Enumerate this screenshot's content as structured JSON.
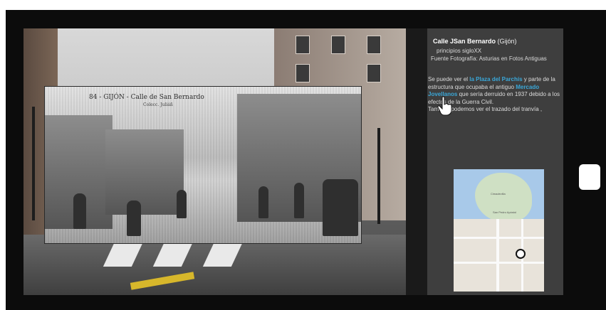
{
  "info_panel": {
    "title_name": "Calle JSan Bernardo",
    "title_city": "(Gijón)",
    "date": "principios sigloXX",
    "source": "Fuente Fotografía: Asturias en Fotos Antiguas",
    "desc_1": "Se puede ver el ",
    "highlight_1": "la Plaza del  Parchís",
    "desc_2": " y parte de la estructura que ocupaba el antiguo ",
    "highlight_2": "Mercado Jovellanos",
    "desc_3": " que sería derruido en 1937  debido a los efectos de la Guerra Civil.",
    "desc_4": "También podemos ver el trazado del tranvía ,"
  },
  "old_photo": {
    "caption": "84 - GIJÓN - Calle de San Bernardo",
    "subcaption": "Colecc. Juliáñ"
  },
  "map": {
    "label_1": "Cimadevilla",
    "label_2": "San Pedro Apóstol"
  },
  "colors": {
    "highlight": "#3aa7d8",
    "panel_bg": "#3e3e3e",
    "frame_bg": "#0c0c0c"
  },
  "icons": {
    "cursor": "hand-pointer-icon",
    "map_marker": "location-marker-icon"
  }
}
